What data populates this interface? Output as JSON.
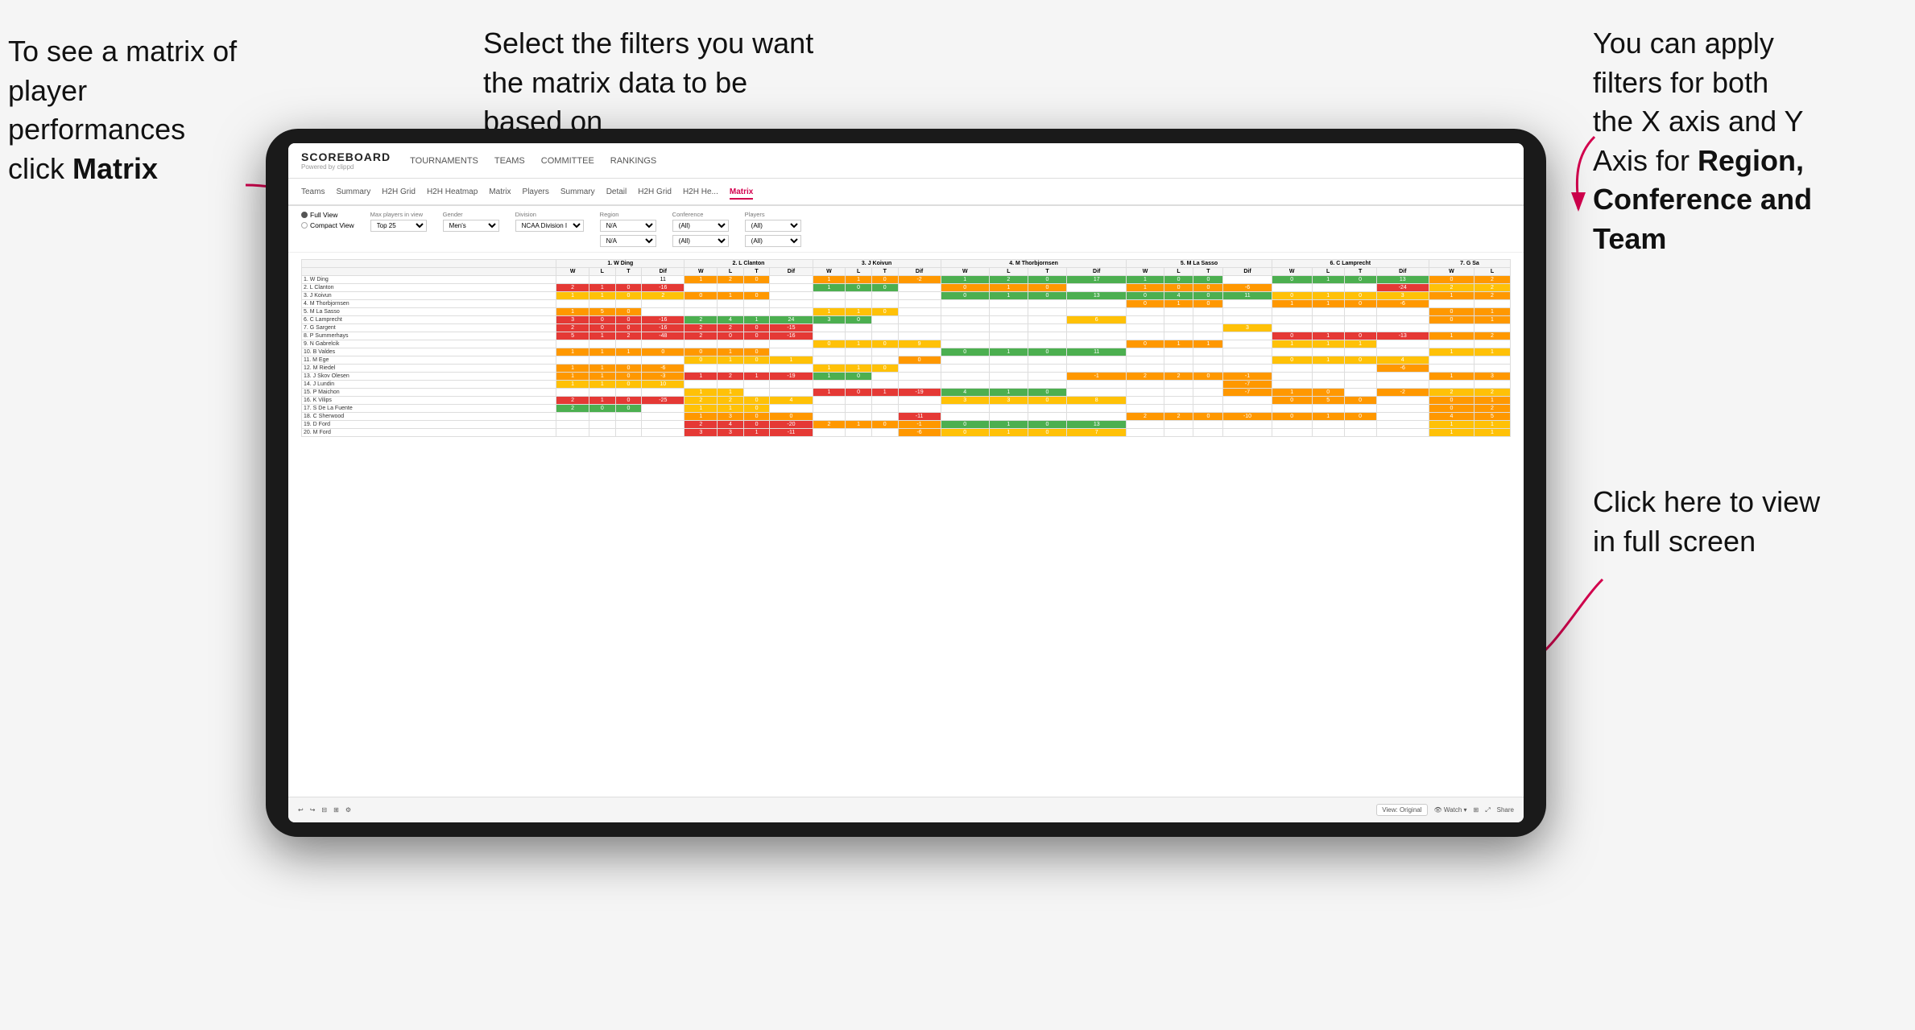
{
  "annotations": {
    "left": {
      "line1": "To see a matrix of",
      "line2": "player performances",
      "line3_plain": "click ",
      "line3_bold": "Matrix"
    },
    "center": {
      "text": "Select the filters you want the matrix data to be based on"
    },
    "right_top": {
      "line1": "You  can apply",
      "line2": "filters for both",
      "line3": "the X axis and Y",
      "line4_plain": "Axis for ",
      "line4_bold": "Region,",
      "line5_bold": "Conference and",
      "line6_bold": "Team"
    },
    "right_bottom": {
      "line1": "Click here to view",
      "line2": "in full screen"
    }
  },
  "nav": {
    "logo_main": "SCOREBOARD",
    "logo_sub": "Powered by clippd",
    "links": [
      "TOURNAMENTS",
      "TEAMS",
      "COMMITTEE",
      "RANKINGS"
    ]
  },
  "sub_nav": {
    "tabs": [
      "Teams",
      "Summary",
      "H2H Grid",
      "H2H Heatmap",
      "Matrix",
      "Players",
      "Summary",
      "Detail",
      "H2H Grid",
      "H2H He...",
      "Matrix"
    ]
  },
  "filters": {
    "view_options": [
      "Full View",
      "Compact View"
    ],
    "max_players_label": "Max players in view",
    "max_players_value": "Top 25",
    "gender_label": "Gender",
    "gender_value": "Men's",
    "division_label": "Division",
    "division_value": "NCAA Division I",
    "region_label": "Region",
    "region_values": [
      "N/A",
      "N/A"
    ],
    "conference_label": "Conference",
    "conference_values": [
      "(All)",
      "(All)"
    ],
    "players_label": "Players",
    "players_values": [
      "(All)",
      "(All)"
    ]
  },
  "matrix": {
    "col_headers": [
      "1. W Ding",
      "2. L Clanton",
      "3. J Koivun",
      "4. M Thorbjornsen",
      "5. M La Sasso",
      "6. C Lamprecht",
      "7. G Sa"
    ],
    "sub_headers": [
      "W",
      "L",
      "T",
      "Dif"
    ],
    "rows": [
      {
        "name": "1. W Ding",
        "cells": [
          [
            "",
            "",
            "",
            "11"
          ],
          [
            "1",
            "2",
            "0",
            ""
          ],
          [
            "1",
            "1",
            "0",
            "-2"
          ],
          [
            "1",
            "2",
            "0",
            "17"
          ],
          [
            "1",
            "0",
            "0",
            ""
          ],
          [
            "0",
            "1",
            "0",
            "13"
          ],
          [
            "0",
            "2",
            ""
          ]
        ]
      },
      {
        "name": "2. L Clanton",
        "cells": [
          [
            "2",
            "1",
            "0",
            "-16"
          ],
          [
            "",
            "",
            "",
            ""
          ],
          [
            "1",
            "0",
            "0",
            ""
          ],
          [
            "0",
            "1",
            "0",
            ""
          ],
          [
            "1",
            "0",
            "0",
            "-6"
          ],
          [
            "",
            "",
            "",
            "-24"
          ],
          [
            "2",
            "2",
            ""
          ]
        ]
      },
      {
        "name": "3. J Koivun",
        "cells": [
          [
            "1",
            "1",
            "0",
            "2"
          ],
          [
            "0",
            "1",
            "0",
            ""
          ],
          [
            "",
            "",
            "",
            ""
          ],
          [
            "0",
            "1",
            "0",
            "13"
          ],
          [
            "0",
            "4",
            "0",
            "11"
          ],
          [
            "0",
            "1",
            "0",
            "3"
          ],
          [
            "1",
            "2",
            ""
          ]
        ]
      },
      {
        "name": "4. M Thorbjornsen",
        "cells": [
          [
            "",
            "",
            "",
            ""
          ],
          [
            "",
            "",
            "",
            ""
          ],
          [
            "",
            "",
            "",
            ""
          ],
          [
            "",
            "",
            "",
            ""
          ],
          [
            "0",
            "1",
            "0",
            ""
          ],
          [
            "1",
            "1",
            "0",
            "-6"
          ],
          [
            "",
            ""
          ]
        ]
      },
      {
        "name": "5. M La Sasso",
        "cells": [
          [
            "1",
            "5",
            "0",
            ""
          ],
          [
            "",
            "",
            "",
            ""
          ],
          [
            "1",
            "1",
            "0",
            ""
          ],
          [
            "",
            "",
            "",
            ""
          ],
          [
            "",
            "",
            "",
            ""
          ],
          [
            "",
            "",
            "",
            ""
          ],
          [
            "0",
            "1",
            ""
          ]
        ]
      },
      {
        "name": "6. C Lamprecht",
        "cells": [
          [
            "3",
            "0",
            "0",
            "-16"
          ],
          [
            "2",
            "4",
            "1",
            "24"
          ],
          [
            "3",
            "0",
            "",
            ""
          ],
          [
            "",
            "",
            "",
            "6"
          ],
          [
            "",
            "",
            "",
            ""
          ],
          [
            "",
            "",
            "",
            ""
          ],
          [
            "0",
            "1",
            ""
          ]
        ]
      },
      {
        "name": "7. G Sargent",
        "cells": [
          [
            "2",
            "0",
            "0",
            "-16"
          ],
          [
            "2",
            "2",
            "0",
            "-15"
          ],
          [
            "",
            "",
            "",
            ""
          ],
          [
            "",
            "",
            "",
            ""
          ],
          [
            "",
            "",
            "",
            "3"
          ],
          [
            "",
            "",
            "",
            ""
          ],
          [
            "",
            ""
          ]
        ]
      },
      {
        "name": "8. P Summerhays",
        "cells": [
          [
            "5",
            "1",
            "2",
            "-48"
          ],
          [
            "2",
            "0",
            "0",
            "-16"
          ],
          [
            "",
            "",
            "",
            ""
          ],
          [
            "",
            "",
            "",
            ""
          ],
          [
            "",
            "",
            "",
            ""
          ],
          [
            "0",
            "1",
            "0",
            "-13"
          ],
          [
            "1",
            "2",
            ""
          ]
        ]
      },
      {
        "name": "9. N Gabrelcik",
        "cells": [
          [
            "",
            "",
            "",
            ""
          ],
          [
            "",
            "",
            "",
            ""
          ],
          [
            "0",
            "1",
            "0",
            "9"
          ],
          [
            "",
            "",
            "",
            ""
          ],
          [
            "0",
            "1",
            "1",
            ""
          ],
          [
            "1",
            "1",
            "1",
            ""
          ],
          [
            "",
            ""
          ]
        ]
      },
      {
        "name": "10. B Valdes",
        "cells": [
          [
            "1",
            "1",
            "1",
            "0"
          ],
          [
            "0",
            "1",
            "0",
            ""
          ],
          [
            "",
            "",
            "",
            ""
          ],
          [
            "0",
            "1",
            "0",
            "11"
          ],
          [
            "",
            "",
            "",
            ""
          ],
          [
            "",
            "",
            "",
            ""
          ],
          [
            "1",
            "1",
            ""
          ]
        ]
      },
      {
        "name": "11. M Ege",
        "cells": [
          [
            "",
            "",
            "",
            ""
          ],
          [
            "0",
            "1",
            "0",
            "1"
          ],
          [
            "",
            "",
            "",
            "0"
          ],
          [
            "",
            "",
            "",
            ""
          ],
          [
            "",
            "",
            "",
            ""
          ],
          [
            "0",
            "1",
            "0",
            "4"
          ],
          [
            "",
            ""
          ]
        ]
      },
      {
        "name": "12. M Riedel",
        "cells": [
          [
            "1",
            "1",
            "0",
            "-6"
          ],
          [
            "",
            "",
            "",
            ""
          ],
          [
            "1",
            "1",
            "0",
            ""
          ],
          [
            "",
            "",
            "",
            ""
          ],
          [
            "",
            "",
            "",
            ""
          ],
          [
            "",
            "",
            "",
            "-6"
          ],
          [
            "",
            ""
          ]
        ]
      },
      {
        "name": "13. J Skov Olesen",
        "cells": [
          [
            "1",
            "1",
            "0",
            "-3"
          ],
          [
            "1",
            "2",
            "1",
            "-19"
          ],
          [
            "1",
            "0",
            "",
            ""
          ],
          [
            "",
            "",
            "",
            "-1"
          ],
          [
            "2",
            "2",
            "0",
            "-1"
          ],
          [
            "",
            "",
            "",
            ""
          ],
          [
            "1",
            "3",
            ""
          ]
        ]
      },
      {
        "name": "14. J Lundin",
        "cells": [
          [
            "1",
            "1",
            "0",
            "10"
          ],
          [
            "",
            "",
            "",
            ""
          ],
          [
            "",
            "",
            "",
            ""
          ],
          [
            "",
            "",
            "",
            ""
          ],
          [
            "",
            "",
            "",
            "-7"
          ],
          [
            "",
            "",
            "",
            ""
          ],
          [
            "",
            ""
          ]
        ]
      },
      {
        "name": "15. P Maichon",
        "cells": [
          [
            "",
            "",
            "",
            ""
          ],
          [
            "1",
            "1",
            "",
            ""
          ],
          [
            "1",
            "0",
            "1",
            "-19"
          ],
          [
            "4",
            "1",
            "0",
            ""
          ],
          [
            "",
            "",
            "",
            "-7"
          ],
          [
            "1",
            "0",
            "",
            "-2"
          ],
          [
            "2",
            "2",
            ""
          ]
        ]
      },
      {
        "name": "16. K Vilips",
        "cells": [
          [
            "2",
            "1",
            "0",
            "-25"
          ],
          [
            "2",
            "2",
            "0",
            "4"
          ],
          [
            "",
            "",
            "",
            ""
          ],
          [
            "3",
            "3",
            "0",
            "8"
          ],
          [
            "",
            "",
            "",
            ""
          ],
          [
            "0",
            "5",
            "0",
            ""
          ],
          [
            "0",
            "1",
            ""
          ]
        ]
      },
      {
        "name": "17. S De La Fuente",
        "cells": [
          [
            "2",
            "0",
            "0",
            ""
          ],
          [
            "1",
            "1",
            "0",
            ""
          ],
          [
            "",
            "",
            "",
            ""
          ],
          [
            "",
            "",
            "",
            ""
          ],
          [
            "",
            "",
            "",
            ""
          ],
          [
            "",
            "",
            "",
            ""
          ],
          [
            "0",
            "2",
            ""
          ]
        ]
      },
      {
        "name": "18. C Sherwood",
        "cells": [
          [
            "",
            "",
            "",
            ""
          ],
          [
            "1",
            "3",
            "0",
            "0"
          ],
          [
            "",
            "",
            "",
            "-11"
          ],
          [
            "",
            "",
            "",
            ""
          ],
          [
            "2",
            "2",
            "0",
            "-10"
          ],
          [
            "0",
            "1",
            "0",
            ""
          ],
          [
            "4",
            "5",
            ""
          ]
        ]
      },
      {
        "name": "19. D Ford",
        "cells": [
          [
            "",
            "",
            "",
            ""
          ],
          [
            "2",
            "4",
            "0",
            "-20"
          ],
          [
            "2",
            "1",
            "0",
            "-1"
          ],
          [
            "0",
            "1",
            "0",
            "13"
          ],
          [
            "",
            "",
            "",
            ""
          ],
          [
            "",
            "",
            "",
            ""
          ],
          [
            "1",
            "1",
            ""
          ]
        ]
      },
      {
        "name": "20. M Ford",
        "cells": [
          [
            "",
            "",
            "",
            ""
          ],
          [
            "3",
            "3",
            "1",
            "-11"
          ],
          [
            "",
            "",
            "",
            "-6"
          ],
          [
            "0",
            "1",
            "0",
            "7"
          ],
          [
            "",
            "",
            "",
            ""
          ],
          [
            "",
            "",
            "",
            ""
          ],
          [
            "1",
            "1",
            ""
          ]
        ]
      }
    ]
  },
  "bottom_bar": {
    "view_label": "View: Original",
    "watch_label": "Watch",
    "share_label": "Share"
  }
}
